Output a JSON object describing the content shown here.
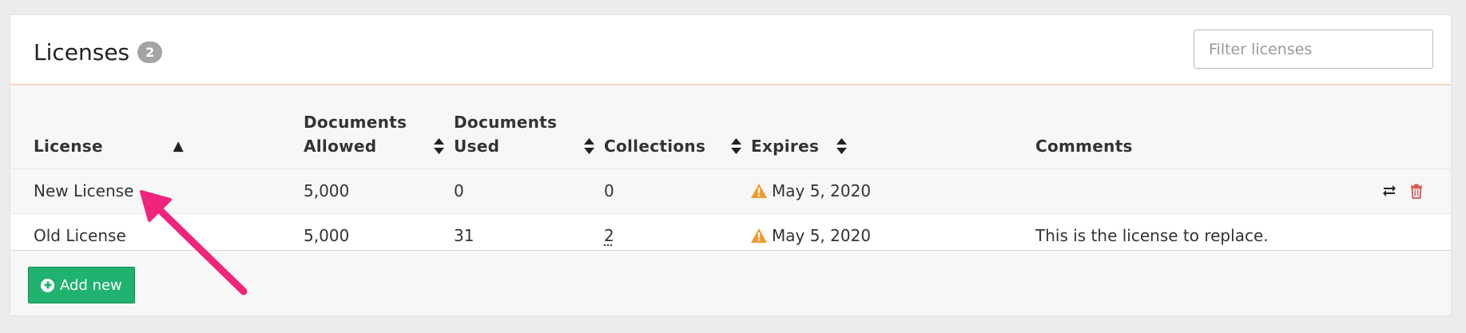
{
  "header": {
    "title": "Licenses",
    "count": "2",
    "filter_placeholder": "Filter licenses",
    "filter_value": ""
  },
  "table": {
    "columns": [
      {
        "line1": "License",
        "line2": "",
        "sort": "asc"
      },
      {
        "line1": "Documents",
        "line2": "Allowed",
        "sort": "both"
      },
      {
        "line1": "Documents",
        "line2": "Used",
        "sort": "both"
      },
      {
        "line1": "Collections",
        "line2": "",
        "sort": "both"
      },
      {
        "line1": "Expires",
        "line2": "",
        "sort": "both"
      },
      {
        "line1": "Comments",
        "line2": "",
        "sort": "none"
      }
    ],
    "sort_asc_glyph": "▲",
    "rows": [
      {
        "license": "New License",
        "documents_allowed": "5,000",
        "documents_used": "0",
        "collections": "0",
        "expires": "May 5, 2020",
        "comments": "",
        "actions": [
          "replace-icon",
          "trash-icon"
        ]
      },
      {
        "license": "Old License",
        "documents_allowed": "5,000",
        "documents_used": "31",
        "collections": "2",
        "expires": "May 5, 2020",
        "comments": "This is the license to replace.",
        "actions": []
      }
    ]
  },
  "footer": {
    "add_button_label": "Add new"
  },
  "colors": {
    "add_button": "#1fb36f",
    "warning": "#f0992b",
    "delete": "#d9534f",
    "header_divider": "#f5d5c1",
    "annotation_arrow": "#f0247a"
  }
}
